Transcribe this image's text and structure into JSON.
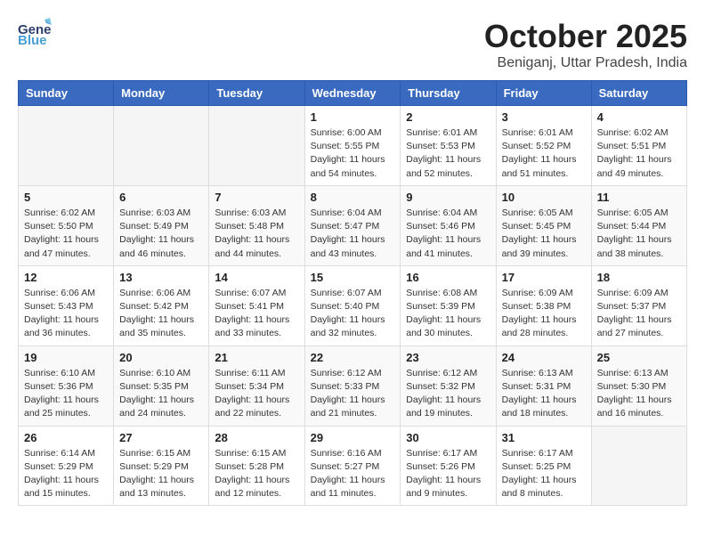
{
  "header": {
    "logo_general": "General",
    "logo_blue": "Blue",
    "month": "October 2025",
    "location": "Beniganj, Uttar Pradesh, India"
  },
  "days_of_week": [
    "Sunday",
    "Monday",
    "Tuesday",
    "Wednesday",
    "Thursday",
    "Friday",
    "Saturday"
  ],
  "weeks": [
    [
      {
        "day": "",
        "info": ""
      },
      {
        "day": "",
        "info": ""
      },
      {
        "day": "",
        "info": ""
      },
      {
        "day": "1",
        "info": "Sunrise: 6:00 AM\nSunset: 5:55 PM\nDaylight: 11 hours\nand 54 minutes."
      },
      {
        "day": "2",
        "info": "Sunrise: 6:01 AM\nSunset: 5:53 PM\nDaylight: 11 hours\nand 52 minutes."
      },
      {
        "day": "3",
        "info": "Sunrise: 6:01 AM\nSunset: 5:52 PM\nDaylight: 11 hours\nand 51 minutes."
      },
      {
        "day": "4",
        "info": "Sunrise: 6:02 AM\nSunset: 5:51 PM\nDaylight: 11 hours\nand 49 minutes."
      }
    ],
    [
      {
        "day": "5",
        "info": "Sunrise: 6:02 AM\nSunset: 5:50 PM\nDaylight: 11 hours\nand 47 minutes."
      },
      {
        "day": "6",
        "info": "Sunrise: 6:03 AM\nSunset: 5:49 PM\nDaylight: 11 hours\nand 46 minutes."
      },
      {
        "day": "7",
        "info": "Sunrise: 6:03 AM\nSunset: 5:48 PM\nDaylight: 11 hours\nand 44 minutes."
      },
      {
        "day": "8",
        "info": "Sunrise: 6:04 AM\nSunset: 5:47 PM\nDaylight: 11 hours\nand 43 minutes."
      },
      {
        "day": "9",
        "info": "Sunrise: 6:04 AM\nSunset: 5:46 PM\nDaylight: 11 hours\nand 41 minutes."
      },
      {
        "day": "10",
        "info": "Sunrise: 6:05 AM\nSunset: 5:45 PM\nDaylight: 11 hours\nand 39 minutes."
      },
      {
        "day": "11",
        "info": "Sunrise: 6:05 AM\nSunset: 5:44 PM\nDaylight: 11 hours\nand 38 minutes."
      }
    ],
    [
      {
        "day": "12",
        "info": "Sunrise: 6:06 AM\nSunset: 5:43 PM\nDaylight: 11 hours\nand 36 minutes."
      },
      {
        "day": "13",
        "info": "Sunrise: 6:06 AM\nSunset: 5:42 PM\nDaylight: 11 hours\nand 35 minutes."
      },
      {
        "day": "14",
        "info": "Sunrise: 6:07 AM\nSunset: 5:41 PM\nDaylight: 11 hours\nand 33 minutes."
      },
      {
        "day": "15",
        "info": "Sunrise: 6:07 AM\nSunset: 5:40 PM\nDaylight: 11 hours\nand 32 minutes."
      },
      {
        "day": "16",
        "info": "Sunrise: 6:08 AM\nSunset: 5:39 PM\nDaylight: 11 hours\nand 30 minutes."
      },
      {
        "day": "17",
        "info": "Sunrise: 6:09 AM\nSunset: 5:38 PM\nDaylight: 11 hours\nand 28 minutes."
      },
      {
        "day": "18",
        "info": "Sunrise: 6:09 AM\nSunset: 5:37 PM\nDaylight: 11 hours\nand 27 minutes."
      }
    ],
    [
      {
        "day": "19",
        "info": "Sunrise: 6:10 AM\nSunset: 5:36 PM\nDaylight: 11 hours\nand 25 minutes."
      },
      {
        "day": "20",
        "info": "Sunrise: 6:10 AM\nSunset: 5:35 PM\nDaylight: 11 hours\nand 24 minutes."
      },
      {
        "day": "21",
        "info": "Sunrise: 6:11 AM\nSunset: 5:34 PM\nDaylight: 11 hours\nand 22 minutes."
      },
      {
        "day": "22",
        "info": "Sunrise: 6:12 AM\nSunset: 5:33 PM\nDaylight: 11 hours\nand 21 minutes."
      },
      {
        "day": "23",
        "info": "Sunrise: 6:12 AM\nSunset: 5:32 PM\nDaylight: 11 hours\nand 19 minutes."
      },
      {
        "day": "24",
        "info": "Sunrise: 6:13 AM\nSunset: 5:31 PM\nDaylight: 11 hours\nand 18 minutes."
      },
      {
        "day": "25",
        "info": "Sunrise: 6:13 AM\nSunset: 5:30 PM\nDaylight: 11 hours\nand 16 minutes."
      }
    ],
    [
      {
        "day": "26",
        "info": "Sunrise: 6:14 AM\nSunset: 5:29 PM\nDaylight: 11 hours\nand 15 minutes."
      },
      {
        "day": "27",
        "info": "Sunrise: 6:15 AM\nSunset: 5:29 PM\nDaylight: 11 hours\nand 13 minutes."
      },
      {
        "day": "28",
        "info": "Sunrise: 6:15 AM\nSunset: 5:28 PM\nDaylight: 11 hours\nand 12 minutes."
      },
      {
        "day": "29",
        "info": "Sunrise: 6:16 AM\nSunset: 5:27 PM\nDaylight: 11 hours\nand 11 minutes."
      },
      {
        "day": "30",
        "info": "Sunrise: 6:17 AM\nSunset: 5:26 PM\nDaylight: 11 hours\nand 9 minutes."
      },
      {
        "day": "31",
        "info": "Sunrise: 6:17 AM\nSunset: 5:25 PM\nDaylight: 11 hours\nand 8 minutes."
      },
      {
        "day": "",
        "info": ""
      }
    ]
  ]
}
